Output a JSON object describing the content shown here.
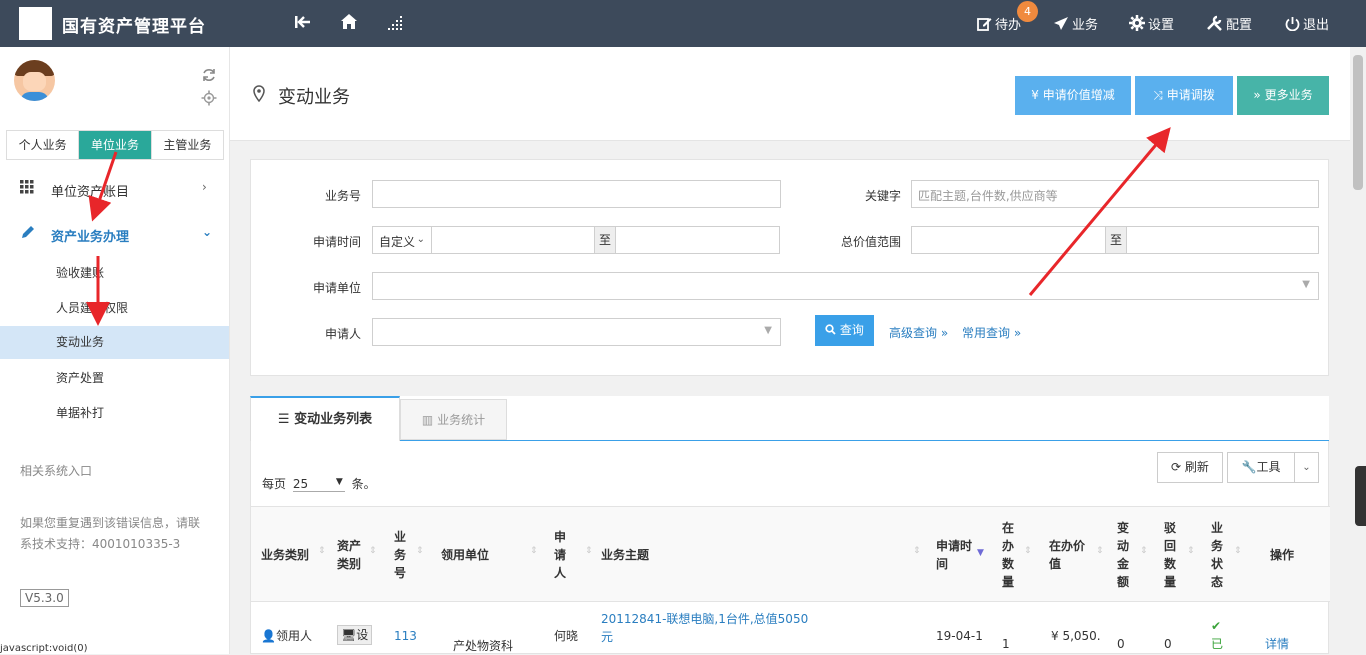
{
  "topbar": {
    "title": "国有资产管理平台",
    "todo_badge": "4",
    "nav": [
      {
        "label": "待办",
        "icon": "edit-icon"
      },
      {
        "label": "业务",
        "icon": "send-icon"
      },
      {
        "label": "设置",
        "icon": "gear-icon"
      },
      {
        "label": "配置",
        "icon": "tools-icon"
      },
      {
        "label": "退出",
        "icon": "power-icon"
      }
    ]
  },
  "sidebar": {
    "tabs": [
      "个人业务",
      "单位业务",
      "主管业务"
    ],
    "menu": [
      {
        "label": "单位资产账目",
        "icon": "grid-icon"
      },
      {
        "label": "资产业务办理",
        "icon": "pencil-icon"
      }
    ],
    "submenu": [
      "验收建账",
      "人员建账权限",
      "变动业务",
      "资产处置",
      "单据补打"
    ],
    "related": "相关系统入口",
    "support_line1": "如果您重复遇到该错误信息，请联",
    "support_line2": "系技术支持：4001010335-3",
    "version": "V5.3.0"
  },
  "page": {
    "title": "变动业务",
    "buttons": [
      "¥ 申请价值增减",
      "申请调拨",
      "» 更多业务"
    ]
  },
  "search": {
    "biz_no_label": "业务号",
    "keyword_label": "关键字",
    "keyword_placeholder": "匹配主题,台件数,供应商等",
    "apply_time_label": "申请时间",
    "apply_time_mode": "自定义",
    "to_label": "至",
    "value_range_label": "总价值范围",
    "unit_label": "申请单位",
    "applicant_label": "申请人",
    "query_label": "查询",
    "advanced_label": "高级查询",
    "common_label": "常用查询"
  },
  "list": {
    "tab_list": "变动业务列表",
    "tab_stats": "业务统计",
    "per_page_prefix": "每页",
    "per_page_value": "25",
    "per_page_suffix": "条。",
    "refresh_label": "刷新",
    "tools_label": "工具",
    "columns": [
      "业务类别",
      "资产类别",
      "业务号",
      "领用单位",
      "申请人",
      "业务主题",
      "申请时间",
      "在办数量",
      "在办价值",
      "变动金额",
      "驳回数量",
      "业务状态",
      "操作"
    ],
    "rows": [
      {
        "biz_type": "领用人",
        "asset_type": "设",
        "biz_no": "113",
        "unit": "产处物资科",
        "applicant": "何晓",
        "subject_line1": "20112841-联想电脑,1台件,总值5050",
        "subject_line2": "元",
        "apply_time": "19-04-1",
        "qty": "1",
        "value": "¥ 5,050.",
        "change": "0",
        "reject": "0",
        "status": "已",
        "action": "详情"
      }
    ]
  },
  "statusbar": {
    "text": "javascript:void(0)"
  },
  "colors": {
    "topbar": "#3d4a5b",
    "accent_green": "#2aa89a",
    "accent_blue": "#3aa0e8",
    "arrow_red": "#e8262a"
  }
}
